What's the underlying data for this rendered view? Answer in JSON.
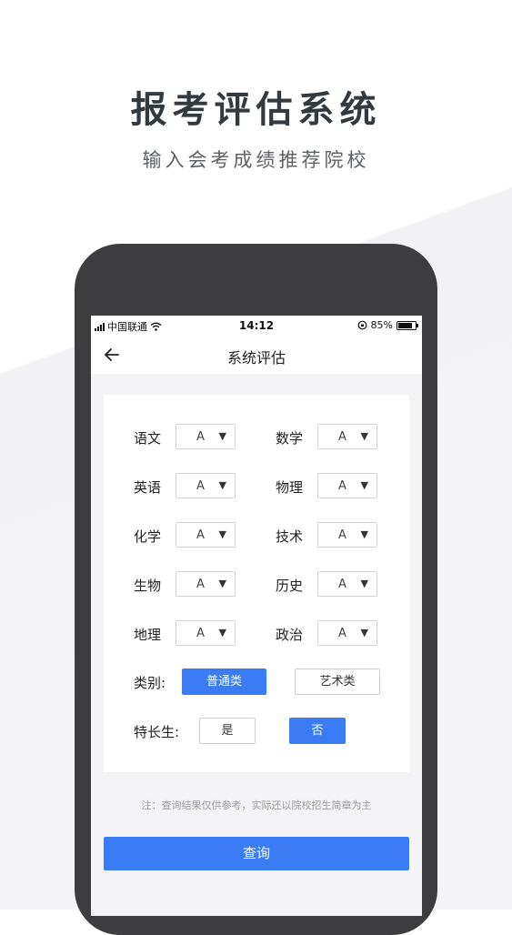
{
  "promo": {
    "title": "报考评估系统",
    "subtitle": "输入会考成绩推荐院校"
  },
  "status_bar": {
    "carrier": "中国联通",
    "time": "14:12",
    "battery": "85%",
    "battery_level": 0.85
  },
  "nav": {
    "title": "系统评估",
    "back_icon": "arrow-left-icon"
  },
  "subjects": [
    {
      "label": "语文",
      "value": "A"
    },
    {
      "label": "数学",
      "value": "A"
    },
    {
      "label": "英语",
      "value": "A"
    },
    {
      "label": "物理",
      "value": "A"
    },
    {
      "label": "化学",
      "value": "A"
    },
    {
      "label": "技术",
      "value": "A"
    },
    {
      "label": "生物",
      "value": "A"
    },
    {
      "label": "历史",
      "value": "A"
    },
    {
      "label": "地理",
      "value": "A"
    },
    {
      "label": "政治",
      "value": "A"
    }
  ],
  "category": {
    "label": "类别:",
    "options": [
      "普通类",
      "艺术类"
    ],
    "selected": "普通类"
  },
  "specialty": {
    "label": "特长生:",
    "options": [
      "是",
      "否"
    ],
    "selected": "否"
  },
  "note": "注：查询结果仅供参考，实际还以院校招生简章为主",
  "query_button": "查询",
  "colors": {
    "accent": "#3b7cf5",
    "phone_frame": "#3d3d40",
    "title_text": "#333a3f"
  }
}
